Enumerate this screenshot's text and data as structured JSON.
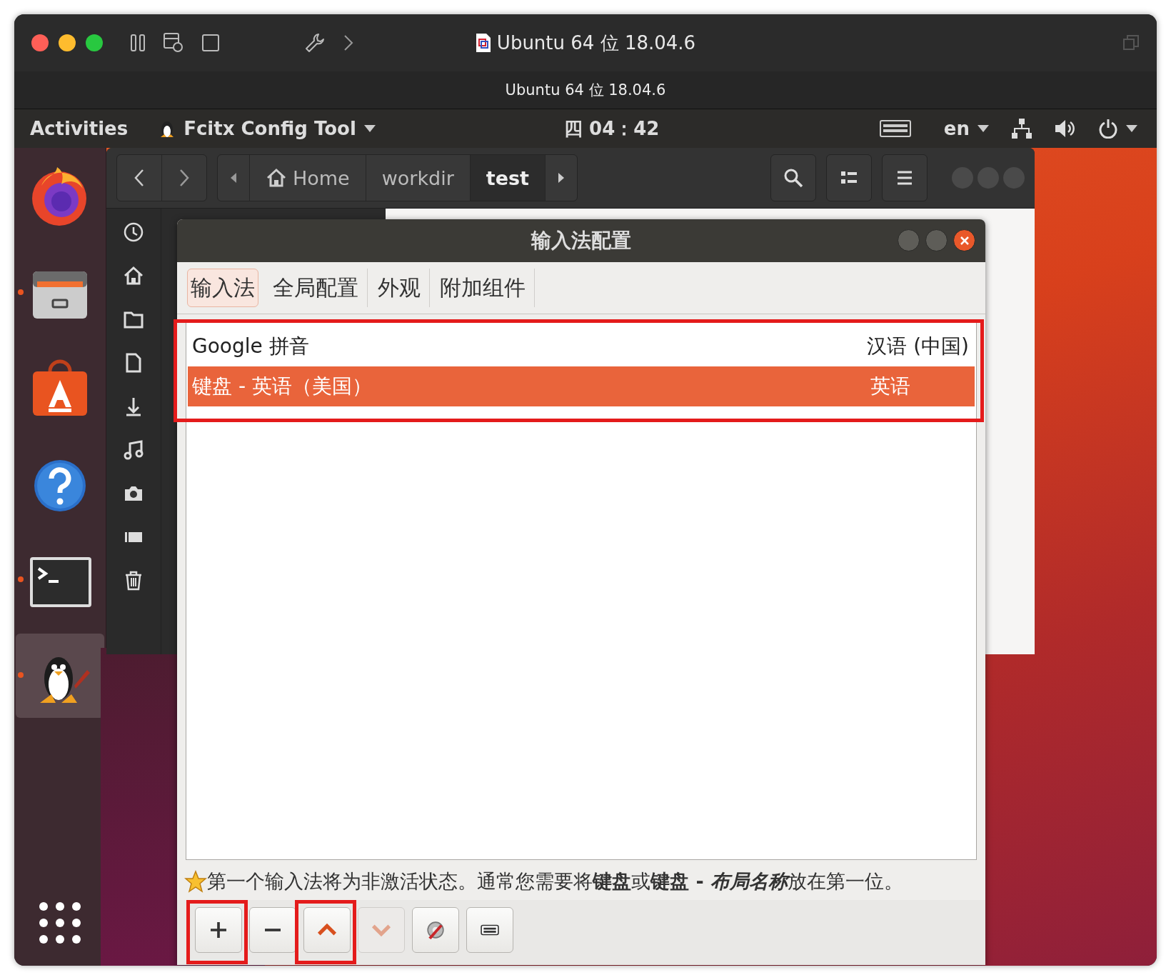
{
  "mac_window": {
    "title": "Ubuntu 64 位 18.04.6",
    "subtitle": "Ubuntu 64 位 18.04.6"
  },
  "top_bar": {
    "activities": "Activities",
    "app_menu": "Fcitx Config Tool",
    "clock": "四 04：42",
    "input_indicator": "en"
  },
  "dock": {
    "items": [
      {
        "kind": "firefox",
        "running": false,
        "selected": false
      },
      {
        "kind": "files",
        "running": true,
        "selected": false
      },
      {
        "kind": "software",
        "running": false,
        "selected": false
      },
      {
        "kind": "help",
        "running": false,
        "selected": false
      },
      {
        "kind": "terminal",
        "running": true,
        "selected": false
      },
      {
        "kind": "penguin",
        "running": true,
        "selected": true
      }
    ]
  },
  "files_window": {
    "path": [
      {
        "label": "Home",
        "kind": "home",
        "selected": false
      },
      {
        "label": "workdir",
        "kind": "folder",
        "selected": false
      },
      {
        "label": "test",
        "kind": "folder",
        "selected": true
      }
    ]
  },
  "dialog": {
    "title": "输入法配置",
    "tabs": [
      {
        "label": "输入法",
        "selected": true
      },
      {
        "label": "全局配置",
        "selected": false
      },
      {
        "label": "外观",
        "selected": false
      },
      {
        "label": "附加组件",
        "selected": false
      }
    ],
    "input_methods": {
      "highlighted": true,
      "rows": [
        {
          "name": "Google 拼音",
          "language": "汉语 (中国)",
          "selected": false
        },
        {
          "name": "键盘 - 英语（美国）",
          "language": "英语",
          "selected": true
        }
      ]
    },
    "hint": [
      {
        "kind": "plain",
        "text": "第一个输入法将为非激活状态。通常您需要将"
      },
      {
        "kind": "bold",
        "text": "键盘"
      },
      {
        "kind": "plain",
        "text": "或"
      },
      {
        "kind": "bold",
        "text": "键盘 - "
      },
      {
        "kind": "bold_italic",
        "text": "布局名称"
      },
      {
        "kind": "plain",
        "text": "放在第一位。"
      }
    ],
    "buttons": [
      {
        "kind": "add",
        "disabled": false,
        "highlighted": true
      },
      {
        "kind": "remove",
        "disabled": false,
        "highlighted": false
      },
      {
        "kind": "up",
        "disabled": false,
        "highlighted": true
      },
      {
        "kind": "down",
        "disabled": true,
        "highlighted": false
      },
      {
        "kind": "configure",
        "disabled": false,
        "highlighted": false
      },
      {
        "kind": "keyboard",
        "disabled": false,
        "highlighted": false
      }
    ]
  }
}
